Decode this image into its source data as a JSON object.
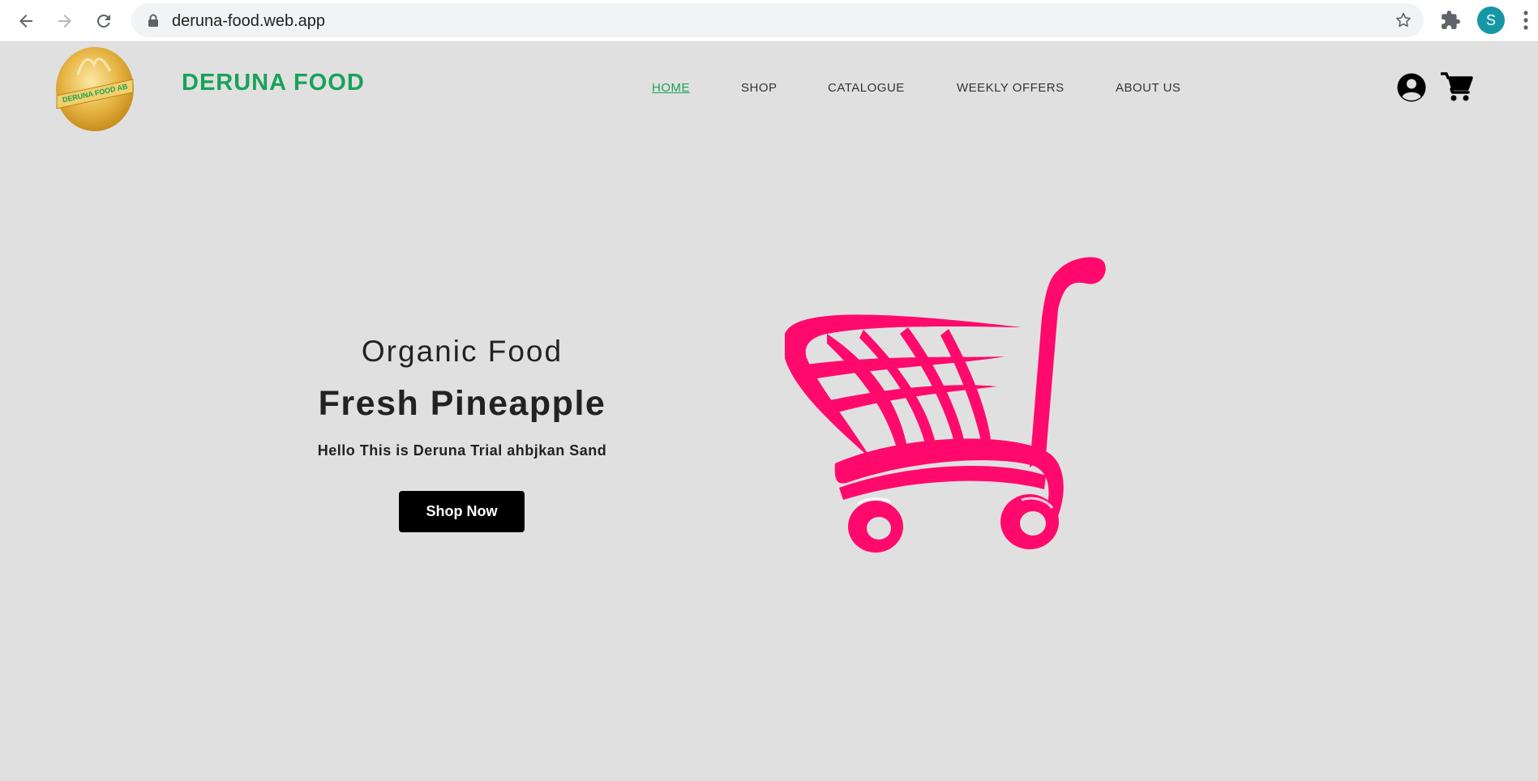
{
  "browser": {
    "url": "deruna-food.web.app",
    "profile_initial": "S"
  },
  "site": {
    "brand": "DERUNA FOOD",
    "logo_text": "DERUNA FOOD AB",
    "nav": [
      {
        "label": "HOME",
        "active": true
      },
      {
        "label": "SHOP",
        "active": false
      },
      {
        "label": "CATALOGUE",
        "active": false
      },
      {
        "label": "WEEKLY OFFERS",
        "active": false
      },
      {
        "label": "ABOUT US",
        "active": false
      }
    ],
    "brand_color": "#19a25a",
    "accent_color": "#ff0a6c"
  },
  "hero": {
    "subtitle": "Organic Food",
    "title": "Fresh Pineapple",
    "description": "Hello This is Deruna Trial ahbjkan Sand",
    "cta_label": "Shop Now"
  }
}
